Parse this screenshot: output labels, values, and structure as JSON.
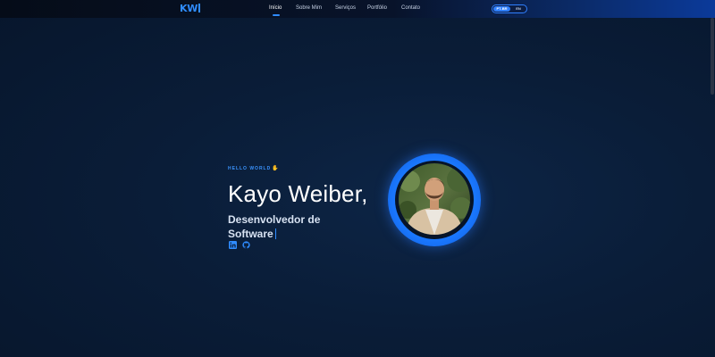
{
  "header": {
    "logo": "KW",
    "nav": [
      "Início",
      "Sobre Mim",
      "Serviços",
      "Portfólio",
      "Contato"
    ],
    "active_index": 0,
    "language": {
      "options": [
        "PT-BR",
        "EN"
      ],
      "selected": "PT-BR"
    }
  },
  "hero": {
    "eyebrow": "HELLO WORLD",
    "name": "Kayo Weiber,",
    "role_line1": "Desenvolvedor de",
    "role_line2": "Software",
    "social_icons": [
      "linkedin-icon",
      "github-icon"
    ]
  },
  "colors": {
    "accent": "#2f8cff",
    "background": "#0a1d38"
  }
}
